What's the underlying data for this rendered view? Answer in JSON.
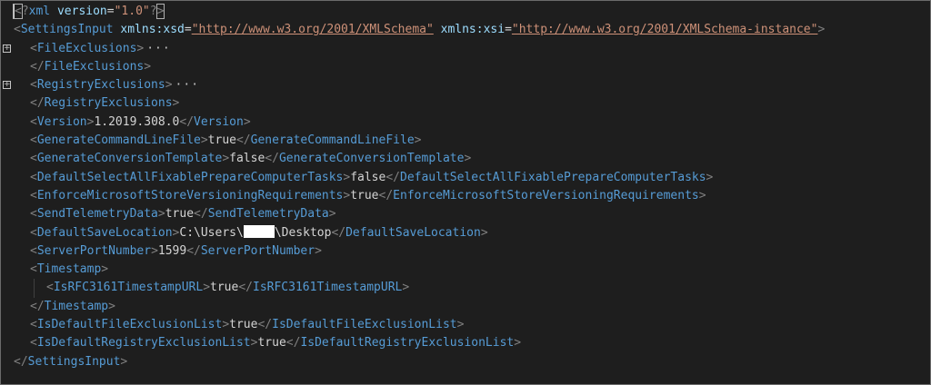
{
  "xml_decl": {
    "open": "<",
    "q1": "?",
    "name": "xml",
    "attr": "version",
    "eq": "=",
    "value": "\"1.0\"",
    "q2": "?",
    "close": ">"
  },
  "root": {
    "name": "SettingsInput",
    "attr1_name": "xmlns:xsd",
    "attr1_value": "\"http://www.w3.org/2001/XMLSchema\"",
    "attr2_name": "xmlns:xsi",
    "attr2_value": "\"http://www.w3.org/2001/XMLSchema-instance\""
  },
  "folded_ellipsis": "···",
  "fold_plus": "+",
  "p": {
    "lt": "<",
    "gt": ">",
    "lts": "</",
    "eq": "="
  },
  "tags": {
    "file_exclusions": "FileExclusions",
    "registry_exclusions": "RegistryExclusions",
    "version": "Version",
    "gen_cmdline": "GenerateCommandLineFile",
    "gen_conversion": "GenerateConversionTemplate",
    "default_select": "DefaultSelectAllFixablePrepareComputerTasks",
    "enforce_store": "EnforceMicrosoftStoreVersioningRequirements",
    "send_telemetry": "SendTelemetryData",
    "default_save": "DefaultSaveLocation",
    "server_port": "ServerPortNumber",
    "timestamp": "Timestamp",
    "is_rfc": "IsRFC3161TimestampURL",
    "is_default_file": "IsDefaultFileExclusionList",
    "is_default_registry": "IsDefaultRegistryExclusionList"
  },
  "values": {
    "version": "1.2019.308.0",
    "gen_cmdline": "true",
    "gen_conversion": "false",
    "default_select": "false",
    "enforce_store": "true",
    "send_telemetry": "true",
    "save_prefix": "C:\\Users\\",
    "save_suffix": "\\Desktop",
    "server_port": "1599",
    "is_rfc": "true",
    "is_default_file": "true",
    "is_default_registry": "true"
  },
  "colors": {
    "background": "#1e1e1e",
    "punctuation": "#808080",
    "tag": "#569cd6",
    "attribute": "#9cdcfe",
    "string": "#ce9178",
    "text": "#d4d4d4"
  }
}
